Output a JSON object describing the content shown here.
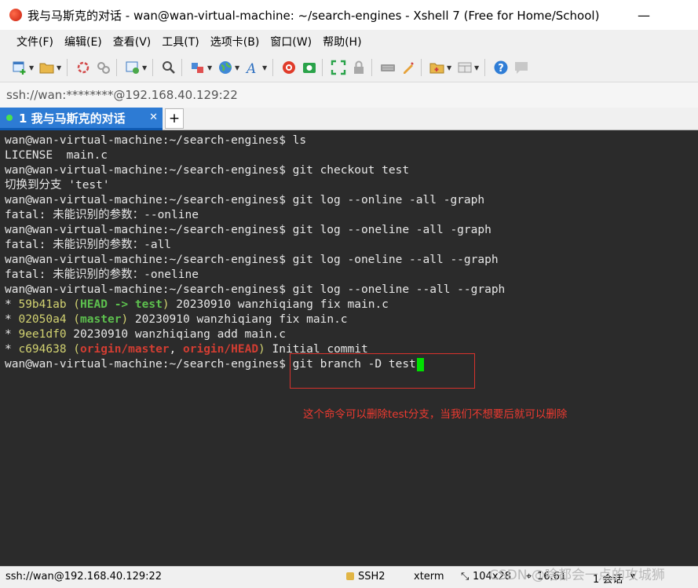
{
  "window": {
    "title": "我与马斯克的对话 - wan@wan-virtual-machine: ~/search-engines - Xshell 7 (Free for Home/School)",
    "min_glyph": "—",
    "max_glyph": "☐",
    "close_glyph": "✕"
  },
  "menu": [
    "文件(F)",
    "编辑(E)",
    "查看(V)",
    "工具(T)",
    "选项卡(B)",
    "窗口(W)",
    "帮助(H)"
  ],
  "toolbar": {
    "icons": [
      "new-session-icon",
      "open-folder-icon",
      "reconnect-icon",
      "disconnect-icon",
      "properties-icon",
      "find-icon",
      "transfer-icon",
      "globe-icon",
      "font-icon",
      "xftp-icon",
      "xmanager-icon",
      "fullscreen-icon",
      "lock-icon",
      "keyboard-icon",
      "script-icon",
      "tab-folder-icon",
      "layout-icon",
      "help-icon",
      "chat-icon"
    ]
  },
  "address": {
    "text": "ssh://wan:********@192.168.40.129:22"
  },
  "tabs": {
    "active_label": "1 我与马斯克的对话",
    "close_glyph": "✕",
    "add_glyph": "+"
  },
  "terminal": {
    "prompt": "wan@wan-virtual-machine:~/search-engines$ ",
    "cmd_ls": "ls",
    "out_ls": "LICENSE  main.c",
    "cmd_checkout": "git checkout test",
    "out_checkout": "切换到分支 'test'",
    "cmd_log1": "git log --online -all -graph",
    "out_log1": "fatal: 未能识别的参数：--online",
    "cmd_log2": "git log --oneline -all -graph",
    "out_log2": "fatal: 未能识别的参数：-all",
    "cmd_log3": "git log -oneline --all --graph",
    "out_log3": "fatal: 未能识别的参数：-oneline",
    "cmd_log4": "git log --oneline --all --graph",
    "commits": [
      {
        "star": "* ",
        "hash": "59b41ab",
        "open": " (",
        "refs": [
          {
            "text": "HEAD -> test",
            "color": "green"
          }
        ],
        "close": ")",
        "msg": " 20230910 wanzhiqiang fix main.c"
      },
      {
        "star": "* ",
        "hash": "02050a4",
        "open": " (",
        "refs": [
          {
            "text": "master",
            "color": "green"
          }
        ],
        "close": ")",
        "msg": " 20230910 wanzhiqiang fix main.c"
      },
      {
        "star": "* ",
        "hash": "9ee1df0",
        "open": "",
        "refs": [],
        "close": "",
        "msg": " 20230910 wanzhiqiang add main.c"
      },
      {
        "star": "* ",
        "hash": "c694638",
        "open": " (",
        "refs": [
          {
            "text": "origin/master",
            "color": "red"
          },
          {
            "text": ", ",
            "color": "plain"
          },
          {
            "text": "origin/HEAD",
            "color": "red"
          }
        ],
        "close": ")",
        "msg": " Initial commit"
      }
    ],
    "cmd_branch": "git branch -D test",
    "annotation": "这个命令可以删除test分支，当我们不想要后就可以删除"
  },
  "status": {
    "address": "ssh://wan@192.168.40.129:22",
    "protocol": "SSH2",
    "terminal": "xterm",
    "size": "104x28",
    "cursor": "16,61",
    "sessions": "1 会话",
    "watermark": "CSDN @啥都会一点的攻城狮"
  },
  "colors": {
    "terminal_bg": "#2b2b2b",
    "hash": "#d2d271",
    "ref_green": "#5dc04e",
    "ref_red": "#d23d32",
    "cursor": "#00e000",
    "tab_active": "#2d7bd4",
    "annotation": "#ee3a30"
  }
}
